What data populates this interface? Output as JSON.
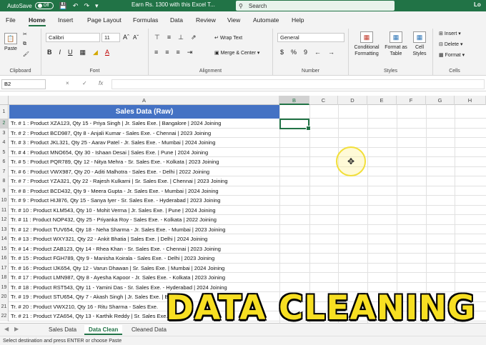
{
  "titlebar": {
    "autosave_label": "AutoSave",
    "autosave_state": "Off",
    "document_title": "Earn Rs. 1300 with this Excel T...",
    "search_placeholder": "Search",
    "user_initials": "Lo"
  },
  "menu": {
    "tabs": [
      "File",
      "Home",
      "Insert",
      "Page Layout",
      "Formulas",
      "Data",
      "Review",
      "View",
      "Automate",
      "Help"
    ],
    "active": "Home"
  },
  "ribbon": {
    "clipboard": {
      "paste": "Paste",
      "label": "Clipboard"
    },
    "font": {
      "name": "Calibri",
      "size": "11",
      "label": "Font",
      "bold": "B",
      "italic": "I",
      "underline": "U"
    },
    "alignment": {
      "wrap": "Wrap Text",
      "merge": "Merge & Center",
      "label": "Alignment"
    },
    "number": {
      "format": "General",
      "currency": "$",
      "percent": "%",
      "comma": "9",
      "label": "Number"
    },
    "styles": {
      "conditional": "Conditional Formatting",
      "format_table": "Format as Table",
      "cell_styles": "Cell Styles",
      "label": "Styles"
    },
    "cells": {
      "insert": "Insert",
      "delete": "Delete",
      "format": "Format",
      "label": "Cells"
    },
    "colors": {
      "accent": "#217346"
    }
  },
  "formula_bar": {
    "name_box": "B2",
    "cancel": "×",
    "enter": "✓",
    "fx": "fx",
    "value": ""
  },
  "grid": {
    "columns": [
      "A",
      "B",
      "C",
      "D",
      "E",
      "F",
      "G",
      "H"
    ],
    "selected_column": "B",
    "selected_row": "2",
    "header_title": "Sales Data (Raw)",
    "header_fill": "#4472c4",
    "rows": [
      {
        "num": "1",
        "a": ""
      },
      {
        "num": "2",
        "a": "Tr. # 1 : Product XZA123, Qty 15 - Priya Singh | Jr. Sales Exe. | Bangalore | 2024 Joining"
      },
      {
        "num": "3",
        "a": "Tr. # 2 : Product BCD987, Qty 8 - Anjali Kumar - Sales Exe. - Chennai | 2023 Joining"
      },
      {
        "num": "4",
        "a": "Tr. # 3 : Product JKL321, Qty 25 - Aarav Patel - Jr. Sales Exe. - Mumbai | 2024 Joining"
      },
      {
        "num": "5",
        "a": "Tr. # 4 : Product MNO654, Qty 30 - Ishaan Desai | Sales Exe. | Pune | 2024 Joining"
      },
      {
        "num": "6",
        "a": "Tr. # 5 : Product PQR789, Qty 12 - Nitya Mehra - Sr. Sales Exe. - Kolkata | 2023 Joining"
      },
      {
        "num": "7",
        "a": "Tr. # 6 : Product VWX987, Qty 20 - Aditi Malhotra - Sales Exe. - Delhi | 2022 Joining"
      },
      {
        "num": "8",
        "a": "Tr. # 7 : Product YZA321, Qty 22 - Rajesh Kulkarni | Sr. Sales Exe. | Chennai | 2023 Joining"
      },
      {
        "num": "9",
        "a": "Tr. # 8 : Product BCD432, Qty 9 - Meera Gupta - Jr. Sales Exe. - Mumbai | 2024 Joining"
      },
      {
        "num": "10",
        "a": "Tr. # 9 : Product HIJ876, Qty 15 - Sanya Iyer - Sr. Sales Exe. - Hyderabad | 2023 Joining"
      },
      {
        "num": "11",
        "a": "Tr. # 10 : Product KLM543, Qty 10 - Mohit Verma | Jr. Sales Exe. | Pune | 2024 Joining"
      },
      {
        "num": "12",
        "a": "Tr. # 11 : Product NOP432, Qty 25 - Priyanka Roy - Sales Exe. - Kolkata | 2022 Joining"
      },
      {
        "num": "13",
        "a": "Tr. # 12 : Product TUV654, Qty 18 - Neha Sharma - Jr. Sales Exe. - Mumbai | 2023 Joining"
      },
      {
        "num": "14",
        "a": "Tr. # 13 : Product WXY321, Qty 22 - Ankit Bhatia | Sales Exe. | Delhi | 2024 Joining"
      },
      {
        "num": "15",
        "a": "Tr. # 14 : Product ZAB123, Qty 14 - Rhea Khan - Sr. Sales Exe. - Chennai | 2023 Joining"
      },
      {
        "num": "16",
        "a": "Tr. # 15 : Product FGH789, Qty 9 - Manisha Koirala - Sales Exe. - Delhi | 2023 Joining"
      },
      {
        "num": "17",
        "a": "Tr. # 16 : Product IJK654, Qty 12 - Varun Dhawan | Sr. Sales Exe. | Mumbai | 2024 Joining"
      },
      {
        "num": "18",
        "a": "Tr. # 17 : Product LMN987, Qty 8 - Ayesha Kapoor - Jr. Sales Exe. - Kolkata | 2023 Joining"
      },
      {
        "num": "19",
        "a": "Tr. # 18 : Product RST543, Qty 11 - Yamini Das - Sr. Sales Exe. - Hyderabad | 2024 Joining"
      },
      {
        "num": "20",
        "a": "Tr. # 19 :  Product STU654, Qty 7 - Akash Singh | Jr. Sales Exe. | Bangalore"
      },
      {
        "num": "21",
        "a": "Tr. # 20 :  Product VWX210, Qty 16 - Ritu Sharma - Sales Exe."
      },
      {
        "num": "22",
        "a": "Tr. # 21 :  Product YZA654, Qty 13 - Karthik Reddy | Sr. Sales Exe."
      }
    ]
  },
  "overlay_text": "DATA CLEANING",
  "sheets": {
    "tabs": [
      "Sales Data",
      "Data Clean",
      "Cleaned Data"
    ],
    "active": "Data Clean"
  },
  "status": "Select destination and press ENTER or choose Paste"
}
